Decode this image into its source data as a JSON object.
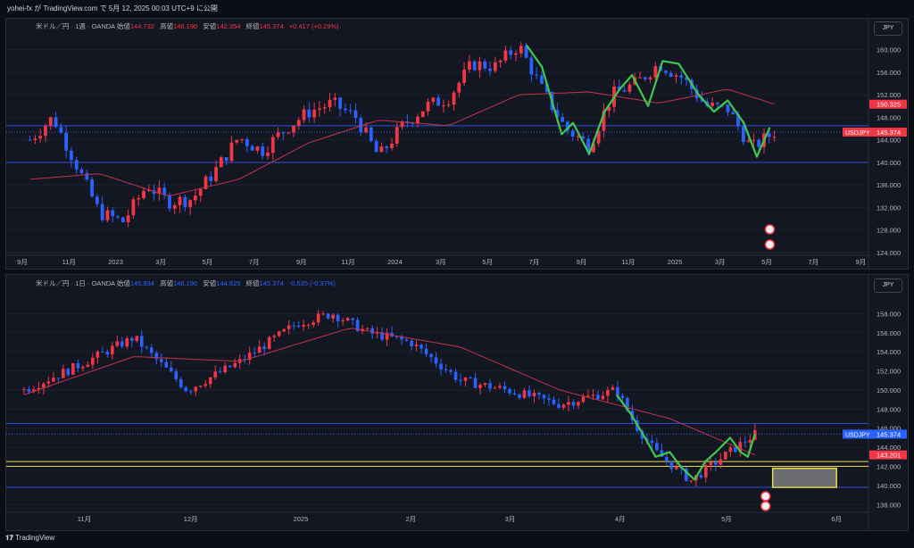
{
  "header": {
    "publish_line": "yohei-fx が TradingView.com で 5月 12, 2025 00:03 UTC+9 に公開"
  },
  "footer": {
    "brand": "TradingView"
  },
  "colors": {
    "up": "#f23645",
    "down": "#2962ff",
    "ma": "#c2334a",
    "hline": "#2f4fdc",
    "zigzag": "#3ec94e",
    "box": "#e6d84a"
  },
  "charts": [
    {
      "name": "weekly",
      "legend": {
        "title": "米ドル／円 · 1週 · OANDA",
        "o_label": "始値",
        "o": "144.732",
        "h_label": "高値",
        "h": "146.190",
        "l_label": "安値",
        "l": "142.354",
        "c_label": "終値",
        "c": "145.374",
        "chg": "+0.417 (+0.29%)"
      },
      "currency_button": "JPY",
      "price_ticks": [
        "160.000",
        "156.000",
        "152.000",
        "148.000",
        "144.000",
        "140.000",
        "136.000",
        "132.000",
        "128.000",
        "124.000"
      ],
      "time_ticks": [
        "9月",
        "11月",
        "2023",
        "3月",
        "5月",
        "7月",
        "9月",
        "11月",
        "2024",
        "3月",
        "5月",
        "7月",
        "9月",
        "11月",
        "2025",
        "3月",
        "5月",
        "7月",
        "9月"
      ],
      "tags": {
        "symbol": "USDJPY",
        "price": "145.374",
        "ma": "150.325"
      }
    },
    {
      "name": "daily",
      "legend": {
        "title": "米ドル／円 · 1日 · OANDA",
        "o_label": "始値",
        "o": "145.834",
        "h_label": "高値",
        "h": "146.190",
        "l_label": "安値",
        "l": "144.825",
        "c_label": "終値",
        "c": "145.374",
        "chg": "-0.535 (-0.37%)"
      },
      "currency_button": "JPY",
      "price_ticks": [
        "158.000",
        "156.000",
        "154.000",
        "152.000",
        "150.000",
        "148.000",
        "146.000",
        "144.000",
        "142.000",
        "140.000",
        "138.000"
      ],
      "time_ticks": [
        "11月",
        "12月",
        "2025",
        "2月",
        "3月",
        "4月",
        "5月",
        "6月"
      ],
      "tags": {
        "symbol": "USDJPY",
        "price": "145.374",
        "ma": "143.201"
      }
    }
  ],
  "chart_data": [
    {
      "type": "candlestick",
      "title": "米ドル／円 · 1週 · OANDA",
      "ylim": [
        124,
        162
      ],
      "xrange": [
        "2022-08",
        "2025-09"
      ],
      "horizontal_lines": [
        146.5,
        140.0
      ],
      "series": [
        {
          "name": "close",
          "dates": [
            "2022-09",
            "2022-10",
            "2022-11",
            "2022-12",
            "2023-01",
            "2023-02",
            "2023-03",
            "2023-04",
            "2023-05",
            "2023-06",
            "2023-07",
            "2023-08",
            "2023-09",
            "2023-10",
            "2023-11",
            "2023-12",
            "2024-01",
            "2024-02",
            "2024-03",
            "2024-04",
            "2024-05",
            "2024-06",
            "2024-07",
            "2024-08",
            "2024-09",
            "2024-10",
            "2024-11",
            "2024-12",
            "2025-01",
            "2025-02",
            "2025-03",
            "2025-04",
            "2025-05"
          ],
          "values": [
            144.0,
            148.0,
            139.5,
            131.0,
            129.5,
            136.0,
            133.0,
            133.5,
            138.5,
            144.5,
            142.0,
            146.0,
            149.0,
            150.5,
            148.0,
            141.0,
            146.5,
            150.0,
            151.4,
            157.5,
            157.0,
            160.8,
            153.0,
            146.0,
            143.0,
            152.0,
            154.0,
            157.5,
            155.0,
            150.0,
            149.5,
            142.5,
            145.374
          ]
        },
        {
          "name": "MA",
          "dates": [
            "2022-09",
            "2022-12",
            "2023-03",
            "2023-06",
            "2023-09",
            "2023-12",
            "2024-03",
            "2024-06",
            "2024-09",
            "2024-12",
            "2025-03",
            "2025-05"
          ],
          "values": [
            137.0,
            138.0,
            134.0,
            137.0,
            143.5,
            147.5,
            146.5,
            152.0,
            152.5,
            150.5,
            153.0,
            150.325
          ]
        }
      ]
    },
    {
      "type": "candlestick",
      "title": "米ドル／円 · 1日 · OANDA",
      "ylim": [
        137,
        160
      ],
      "xrange": [
        "2024-10-10",
        "2025-06-10"
      ],
      "horizontal_lines": [
        146.5,
        139.8,
        142.5,
        142.0
      ],
      "series": [
        {
          "name": "close",
          "dates": [
            "2024-10-15",
            "2024-10-30",
            "2024-11-15",
            "2024-11-30",
            "2024-12-15",
            "2024-12-31",
            "2025-01-10",
            "2025-01-20",
            "2025-02-01",
            "2025-02-15",
            "2025-02-28",
            "2025-03-15",
            "2025-03-31",
            "2025-04-05",
            "2025-04-11",
            "2025-04-21",
            "2025-04-30",
            "2025-05-09"
          ],
          "values": [
            150.0,
            152.5,
            155.5,
            150.0,
            153.0,
            157.0,
            158.0,
            156.0,
            155.0,
            151.0,
            150.0,
            148.5,
            150.0,
            146.5,
            143.5,
            140.5,
            143.0,
            145.374
          ]
        },
        {
          "name": "MA",
          "dates": [
            "2024-10-15",
            "2024-11-15",
            "2024-12-15",
            "2025-01-15",
            "2025-02-15",
            "2025-03-15",
            "2025-04-15",
            "2025-05-09"
          ],
          "values": [
            149.5,
            153.5,
            153.0,
            156.5,
            154.5,
            150.0,
            147.0,
            143.201
          ]
        }
      ]
    }
  ]
}
